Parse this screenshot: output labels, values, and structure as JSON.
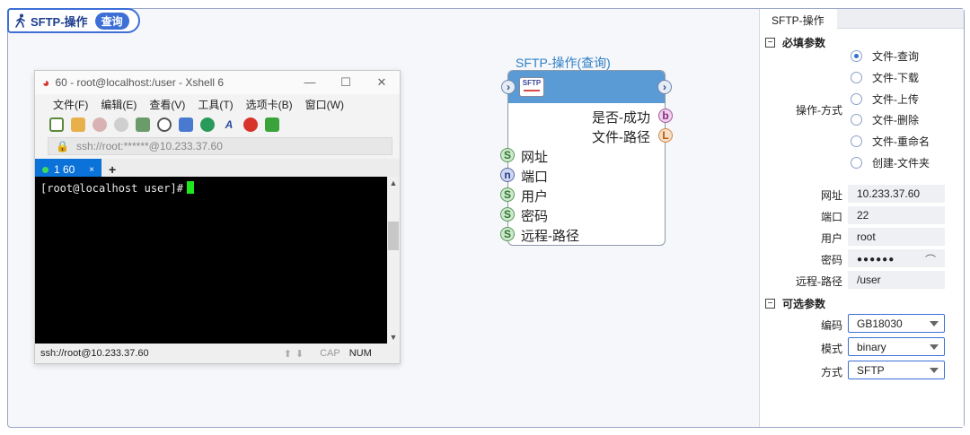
{
  "header": {
    "title": "SFTP-操作",
    "badge": "查询"
  },
  "xshell": {
    "window_title": "60 - root@localhost:/user - Xshell 6",
    "menu": [
      "文件(F)",
      "编辑(E)",
      "查看(V)",
      "工具(T)",
      "选项卡(B)",
      "窗口(W)"
    ],
    "address": "ssh://root:******@10.233.37.60",
    "tab_label": "1 60",
    "prompt": "[root@localhost user]#",
    "status_conn": "ssh://root@10.233.37.60",
    "status_cap": "CAP",
    "status_num": "NUM"
  },
  "node": {
    "title": "SFTP-操作(查询)",
    "icon_label": "SFTP",
    "outputs": [
      {
        "label": "是否-成功",
        "port": "b"
      },
      {
        "label": "文件-路径",
        "port": "L"
      }
    ],
    "inputs": [
      {
        "label": "网址",
        "port": "S"
      },
      {
        "label": "端口",
        "port": "n"
      },
      {
        "label": "用户",
        "port": "S"
      },
      {
        "label": "密码",
        "port": "S"
      },
      {
        "label": "远程-路径",
        "port": "S"
      }
    ]
  },
  "panel": {
    "tab": "SFTP-操作",
    "required_section": "必填参数",
    "operation_label": "操作-方式",
    "operations": [
      "文件-查询",
      "文件-下载",
      "文件-上传",
      "文件-删除",
      "文件-重命名",
      "创建-文件夹"
    ],
    "selected_operation": "文件-查询",
    "fields": [
      {
        "label": "网址",
        "value": "10.233.37.60"
      },
      {
        "label": "端口",
        "value": "22"
      },
      {
        "label": "用户",
        "value": "root"
      },
      {
        "label": "密码",
        "value": "●●●●●●"
      },
      {
        "label": "远程-路径",
        "value": "/user"
      }
    ],
    "optional_section": "可选参数",
    "selects": [
      {
        "label": "编码",
        "value": "GB18030"
      },
      {
        "label": "模式",
        "value": "binary"
      },
      {
        "label": "方式",
        "value": "SFTP"
      }
    ]
  }
}
